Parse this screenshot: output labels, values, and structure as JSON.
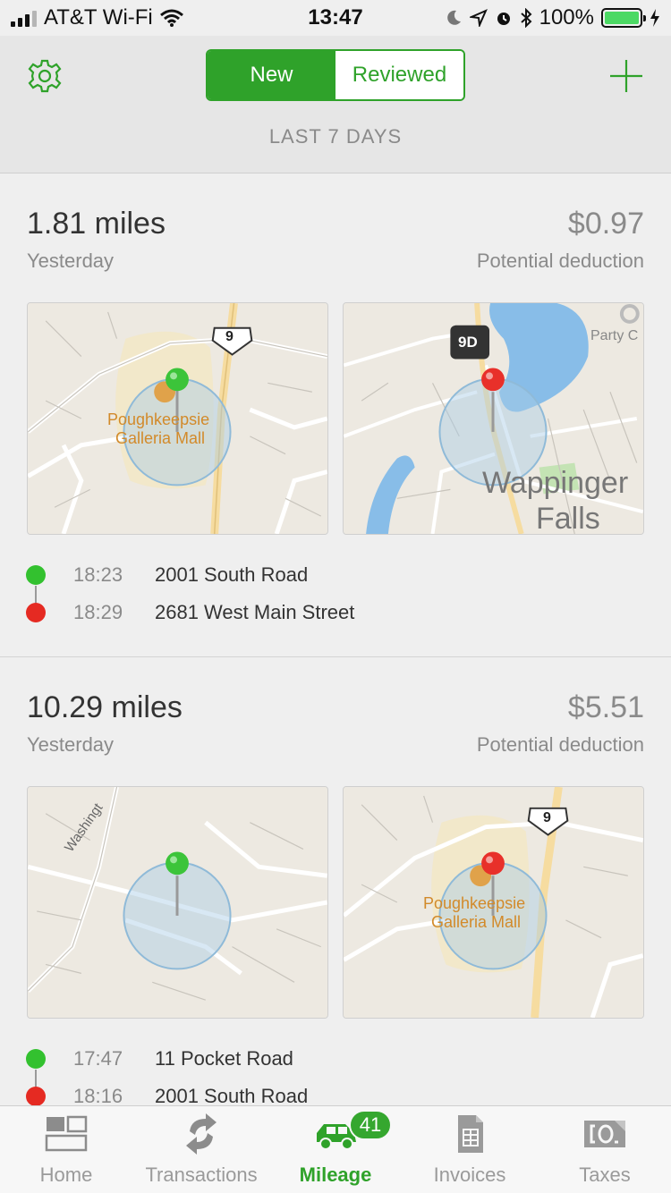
{
  "status_bar": {
    "carrier": "AT&T Wi-Fi",
    "time": "13:47",
    "battery_percent": "100%",
    "icons": [
      "signal-icon",
      "wifi-icon",
      "moon-icon",
      "location-arrow-icon",
      "alarm-icon",
      "bluetooth-icon",
      "battery-icon",
      "charging-bolt-icon"
    ]
  },
  "header": {
    "segments": [
      "New",
      "Reviewed"
    ],
    "active_segment": "New",
    "period_label": "LAST 7 DAYS",
    "left_icon": "gear-icon",
    "right_icon": "plus-icon",
    "accent_color": "#2fa22a"
  },
  "trips": [
    {
      "miles": "1.81 miles",
      "when": "Yesterday",
      "amount": "$0.97",
      "deduction_label": "Potential deduction",
      "start_map": {
        "place": [
          "Poughkeepsie",
          "Galleria Mall"
        ],
        "route_shield": "9",
        "pin_color": "#3cc43a"
      },
      "end_map": {
        "place": [
          "Wappinger",
          "Falls"
        ],
        "route_shield": "9D",
        "poi": "Party C",
        "pin_color": "#e8302a"
      },
      "stops": [
        {
          "time": "18:23",
          "address": "2001 South Road",
          "color": "#33c12f"
        },
        {
          "time": "18:29",
          "address": "2681 West Main Street",
          "color": "#e52a22"
        }
      ]
    },
    {
      "miles": "10.29 miles",
      "when": "Yesterday",
      "amount": "$5.51",
      "deduction_label": "Potential deduction",
      "start_map": {
        "street": "Washingt",
        "pin_color": "#3cc43a"
      },
      "end_map": {
        "place": [
          "Poughkeepsie",
          "Galleria Mall"
        ],
        "route_shield": "9",
        "pin_color": "#e8302a"
      },
      "stops": [
        {
          "time": "17:47",
          "address": "11 Pocket Road",
          "color": "#33c12f"
        },
        {
          "time": "18:16",
          "address": "2001 South Road",
          "color": "#e52a22"
        }
      ]
    }
  ],
  "tabbar": {
    "tabs": [
      {
        "label": "Home",
        "icon": "home-icon"
      },
      {
        "label": "Transactions",
        "icon": "transactions-icon"
      },
      {
        "label": "Mileage",
        "icon": "car-icon"
      },
      {
        "label": "Invoices",
        "icon": "invoice-icon"
      },
      {
        "label": "Taxes",
        "icon": "taxes-icon"
      }
    ],
    "active_tab": "Mileage",
    "mileage_badge": "41"
  }
}
